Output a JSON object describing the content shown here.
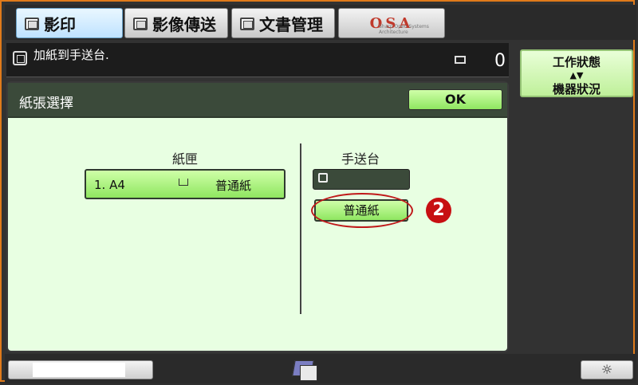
{
  "tabs": [
    {
      "label": "影印",
      "active": true
    },
    {
      "label": "影像傳送",
      "active": false
    },
    {
      "label": "文書管理",
      "active": false
    },
    {
      "label": "OSA",
      "sub": "Sharp Open Systems Architecture",
      "active": false
    }
  ],
  "message": {
    "text": "加紙到手送台.",
    "copy_count": "0"
  },
  "status_button": {
    "line1": "工作狀態",
    "arrows": "▲▼",
    "line2": "機器狀況"
  },
  "panel": {
    "title": "紙張選擇",
    "ok_label": "OK",
    "tray": {
      "heading": "紙匣",
      "number": "1. A4",
      "type": "普通紙"
    },
    "bypass": {
      "heading": "手送台",
      "paper_type": "普通紙"
    }
  },
  "annotation": {
    "step": "2",
    "color": "#c70f12"
  },
  "bottom": {
    "brightness_icon": "☼"
  },
  "colors": {
    "accent_green": "#8fe660",
    "header_dark": "#3b4a3a",
    "panel_bg": "#e8ffe2",
    "frame_orange": "#e07a1a"
  }
}
